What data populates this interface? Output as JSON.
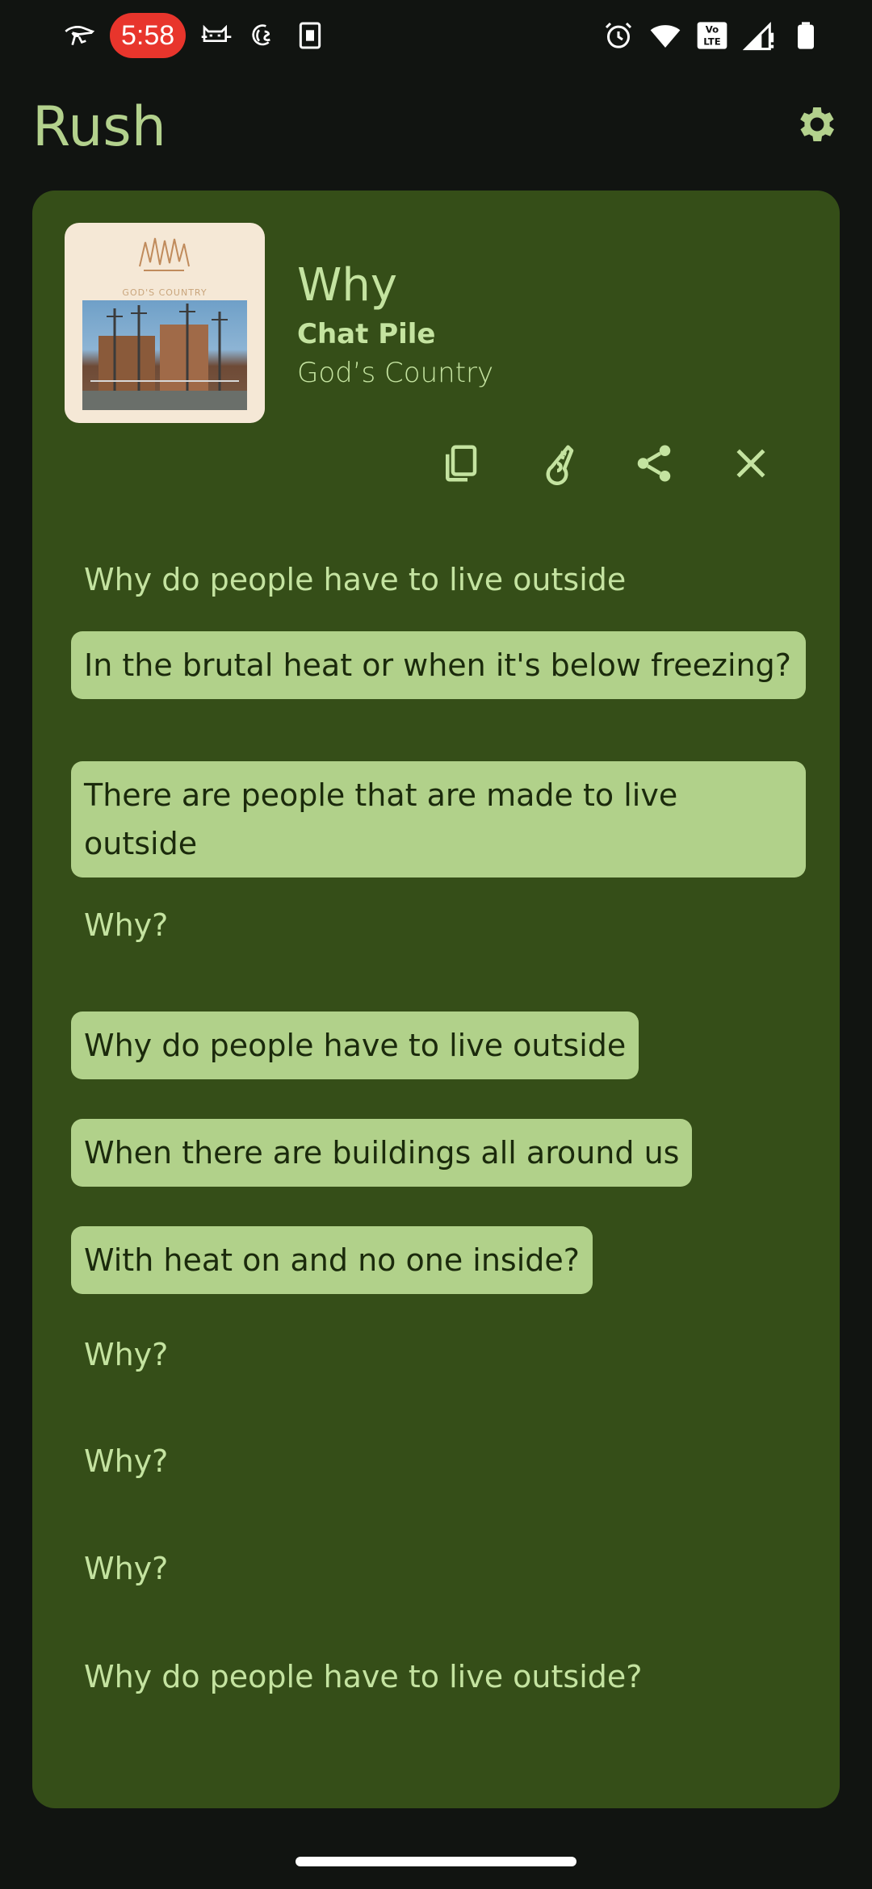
{
  "status_bar": {
    "time": "5:58",
    "left_icons": [
      "eye-of-horus-icon",
      "cat-icon",
      "news-icon",
      "sim-card-icon"
    ],
    "right_icons": [
      "alarm-icon",
      "wifi-icon",
      "volte-icon",
      "signal-icon",
      "battery-icon"
    ],
    "volte_label": "Vo LTE"
  },
  "app": {
    "title": "Rush",
    "settings_icon": "gear-icon"
  },
  "song": {
    "title": "Why",
    "artist": "Chat Pile",
    "album": "God’s Country",
    "art_caption": "GOD'S COUNTRY"
  },
  "actions": [
    {
      "name": "copy-button",
      "icon": "copy-icon"
    },
    {
      "name": "transliterate-button",
      "icon": "translate-icon"
    },
    {
      "name": "share-button",
      "icon": "share-icon"
    },
    {
      "name": "close-button",
      "icon": "close-icon"
    }
  ],
  "lyrics": [
    {
      "text": "Why do people have to live outside",
      "highlighted": false
    },
    {
      "text": "In the brutal heat or when it's below freezing?",
      "highlighted": true
    },
    {
      "text": "There are people that are made to live outside",
      "highlighted": true
    },
    {
      "text": "Why?",
      "highlighted": false
    },
    {
      "text": "Why do people have to live outside",
      "highlighted": true
    },
    {
      "text": "When there are buildings all around us",
      "highlighted": true
    },
    {
      "text": "With heat on and no one inside?",
      "highlighted": true
    },
    {
      "text": "Why?",
      "highlighted": false
    },
    {
      "text": "Why?",
      "highlighted": false
    },
    {
      "text": "Why?",
      "highlighted": false
    },
    {
      "text": "Why do people have to live outside?",
      "highlighted": false
    }
  ],
  "colors": {
    "background": "#111411",
    "card": "#354e18",
    "accent": "#b3d18d",
    "highlight": "#b1d18a",
    "time_pill": "#e8352c"
  }
}
